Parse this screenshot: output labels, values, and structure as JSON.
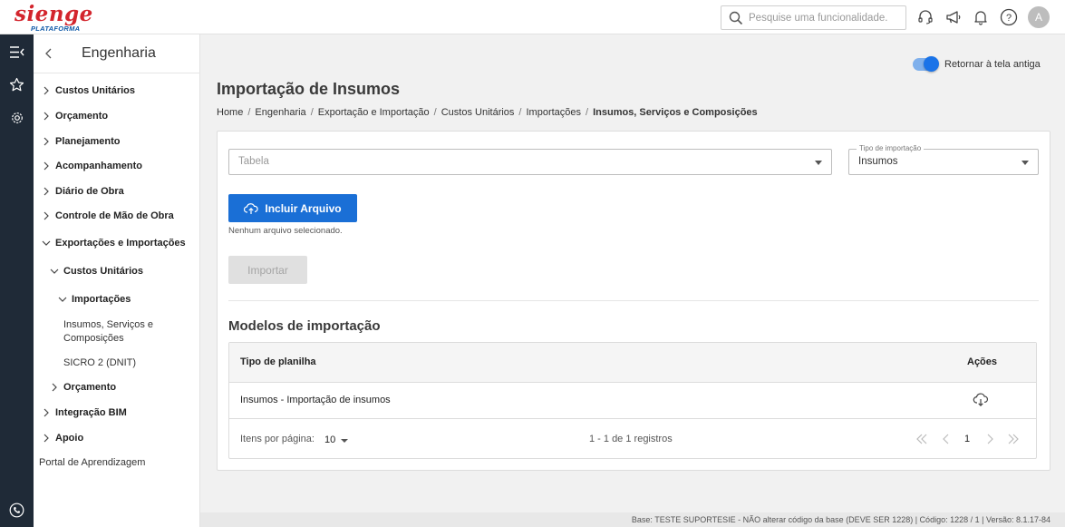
{
  "brand": {
    "logo_word": "sienge",
    "logo_sub": "PLATAFORMA"
  },
  "topbar": {
    "search_placeholder": "Pesquise uma funcionalidade.",
    "avatar_initial": "A"
  },
  "sidebar": {
    "title": "Engenharia",
    "items": [
      {
        "label": "Custos Unitários"
      },
      {
        "label": "Orçamento"
      },
      {
        "label": "Planejamento"
      },
      {
        "label": "Acompanhamento"
      },
      {
        "label": "Diário de Obra"
      },
      {
        "label": "Controle de Mão de Obra"
      },
      {
        "label": "Exportações e Importações"
      },
      {
        "label": "Custos Unitários"
      },
      {
        "label": "Importações"
      },
      {
        "label": "Insumos, Serviços e Composições"
      },
      {
        "label": "SICRO 2 (DNIT)"
      },
      {
        "label": "Orçamento"
      },
      {
        "label": "Integração BIM"
      },
      {
        "label": "Apoio"
      },
      {
        "label": "Portal de Aprendizagem"
      }
    ]
  },
  "toggle": {
    "label": "Retornar à tela antiga",
    "on": true
  },
  "page": {
    "title": "Importação de Insumos",
    "breadcrumb": [
      "Home",
      "Engenharia",
      "Exportação e Importação",
      "Custos Unitários",
      "Importações",
      "Insumos, Serviços e Composições"
    ]
  },
  "form": {
    "tabela_placeholder": "Tabela",
    "tipo_legend": "Tipo de importação",
    "tipo_value": "Insumos",
    "include_button": "Incluir Arquivo",
    "no_file": "Nenhum arquivo selecionado.",
    "import_button": "Importar"
  },
  "models": {
    "title": "Modelos de importação",
    "columns": [
      "Tipo de planilha",
      "Ações"
    ],
    "rows": [
      {
        "tipo": "Insumos - Importação de insumos",
        "action_icon": "cloud-download-icon"
      }
    ],
    "pager": {
      "per_page_label": "Itens por página:",
      "per_page": "10",
      "range": "1 - 1 de 1 registros",
      "page": "1"
    }
  },
  "footer": {
    "text": "Base: TESTE SUPORTESIE - NÃO alterar código da base (DEVE SER 1228) | Código: 1228 / 1 | Versão: 8.1.17-84"
  },
  "colors": {
    "primary": "#1a6fd6",
    "brand_red": "#d3252d",
    "brand_blue": "#0f5aa8",
    "rail": "#1f2a37"
  }
}
